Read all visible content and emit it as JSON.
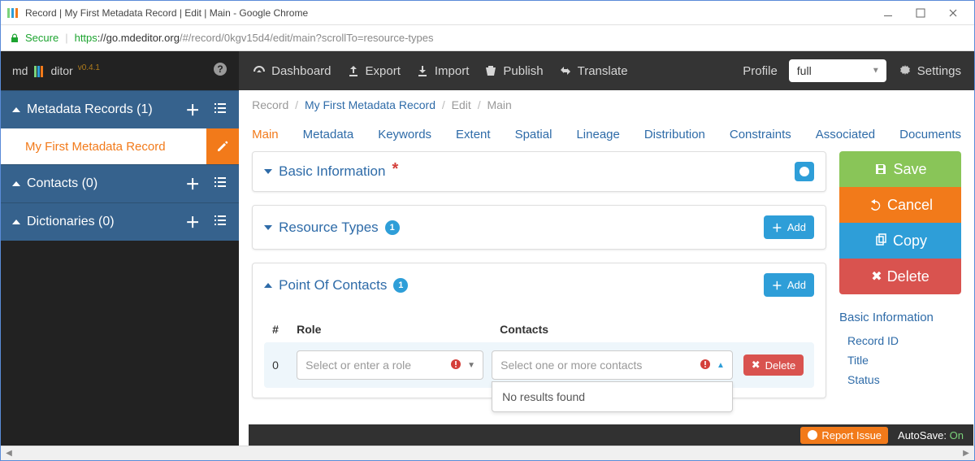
{
  "browser": {
    "title": "Record | My First Metadata Record | Edit | Main - Google Chrome",
    "secure_label": "Secure",
    "url_proto": "https",
    "url_host": "://go.mdeditor.org",
    "url_path": "/#/record/0kgv15d4/edit/main?scrollTo=resource-types"
  },
  "brand": {
    "prefix": "md",
    "suffix": "ditor",
    "version": "v0.4.1"
  },
  "sidebar": {
    "sections": [
      {
        "label": "Metadata Records (1)"
      },
      {
        "label": "Contacts (0)"
      },
      {
        "label": "Dictionaries (0)"
      }
    ],
    "record_item": "My First Metadata Record"
  },
  "topnav": {
    "items": [
      "Dashboard",
      "Export",
      "Import",
      "Publish",
      "Translate"
    ],
    "profile_label": "Profile",
    "profile_value": "full",
    "settings_label": "Settings"
  },
  "breadcrumb": {
    "parts": [
      "Record",
      "My First Metadata Record",
      "Edit",
      "Main"
    ]
  },
  "tabs": [
    "Main",
    "Metadata",
    "Keywords",
    "Extent",
    "Spatial",
    "Lineage",
    "Distribution",
    "Constraints",
    "Associated",
    "Documents"
  ],
  "panels": {
    "basic": {
      "title": "Basic Information"
    },
    "resource": {
      "title": "Resource Types",
      "count": "1",
      "add_label": "Add"
    },
    "poc": {
      "title": "Point Of Contacts",
      "count": "1",
      "add_label": "Add",
      "col_idx": "#",
      "col_role": "Role",
      "col_contacts": "Contacts",
      "row_index": "0",
      "role_placeholder": "Select or enter a role",
      "contacts_placeholder": "Select one or more contacts",
      "delete_label": "Delete",
      "no_results": "No results found"
    }
  },
  "actions": {
    "save": "Save",
    "cancel": "Cancel",
    "copy": "Copy",
    "delete": "Delete"
  },
  "sidenav": {
    "header": "Basic Information",
    "items": [
      "Record ID",
      "Title",
      "Status"
    ]
  },
  "footer": {
    "report": "Report Issue",
    "autosave_label": "AutoSave:",
    "autosave_value": "On"
  }
}
